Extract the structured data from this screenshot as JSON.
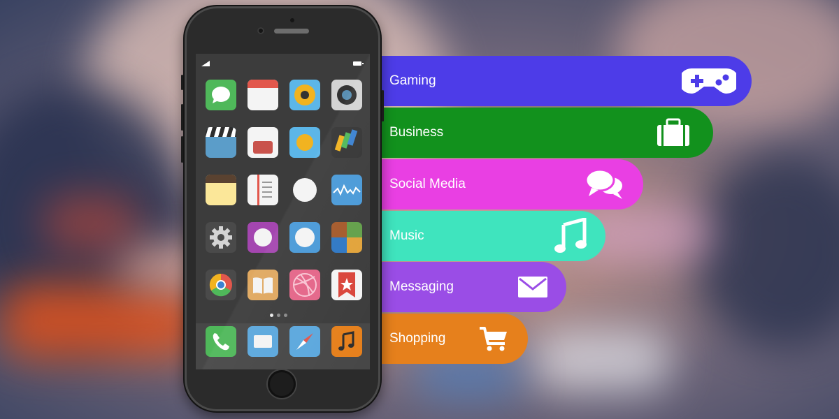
{
  "categories": [
    {
      "label": "Gaming",
      "color": "#4d3ce8",
      "icon": "gamepad-icon"
    },
    {
      "label": "Business",
      "color": "#12911d",
      "icon": "briefcase-icon"
    },
    {
      "label": "Social Media",
      "color": "#e93fe3",
      "icon": "chat-bubbles-icon"
    },
    {
      "label": "Music",
      "color": "#3fe4be",
      "icon": "music-note-icon"
    },
    {
      "label": "Messaging",
      "color": "#9a4de6",
      "icon": "envelope-icon"
    },
    {
      "label": "Shopping",
      "color": "#e6801c",
      "icon": "shopping-cart-icon"
    }
  ],
  "phone": {
    "home_apps": [
      [
        "messages-icon",
        "calendar-icon",
        "camera-lens-icon",
        "photo-lens-icon"
      ],
      [
        "clapperboard-icon",
        "wallet-icon",
        "weather-icon",
        "cards-icon"
      ],
      [
        "notes-icon",
        "book-list-icon",
        "circle-app-icon",
        "stocks-icon"
      ],
      [
        "settings-gear-icon",
        "purple-app-icon",
        "blue-app-icon",
        "grid-app-icon"
      ],
      [
        "chrome-icon",
        "ibooks-icon",
        "dribbble-icon",
        "bookmark-star-icon"
      ]
    ],
    "dock_apps": [
      "phone-icon",
      "mail-icon",
      "compass-icon",
      "music-app-icon"
    ],
    "page_dots": 3,
    "active_page": 1
  }
}
